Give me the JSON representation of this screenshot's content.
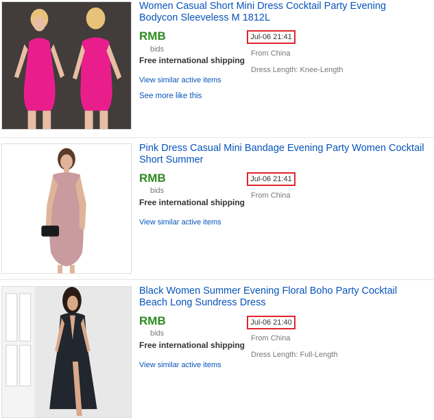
{
  "listings": [
    {
      "title": "Women Casual Short Mini Dress Cocktail Party Evening Bodycon Sleeveless M 1812L",
      "price": "RMB",
      "bids": "bids",
      "shipping": "Free international shipping",
      "similar": "View similar active items",
      "see_more": "See more like this",
      "time": "Jul-06 21:41",
      "from": "From China",
      "spec": "Dress Length: Knee-Length"
    },
    {
      "title": "Pink Dress Casual Mini Bandage Evening Party Women Cocktail Short Summer",
      "price": "RMB",
      "bids": "bids",
      "shipping": "Free international shipping",
      "similar": "View similar active items",
      "time": "Jul-06 21:41",
      "from": "From China"
    },
    {
      "title": "Black Women Summer Evening Floral Boho Party Cocktail Beach Long Sundress Dress",
      "price": "RMB",
      "bids": "bids",
      "shipping": "Free international shipping",
      "similar": "View similar active items",
      "time": "Jul-06 21:40",
      "from": "From China",
      "spec": "Dress Length: Full-Length"
    }
  ],
  "colors": {
    "link": "#0654ba",
    "price": "#2b8a1f",
    "highlight": "#e0242a"
  }
}
